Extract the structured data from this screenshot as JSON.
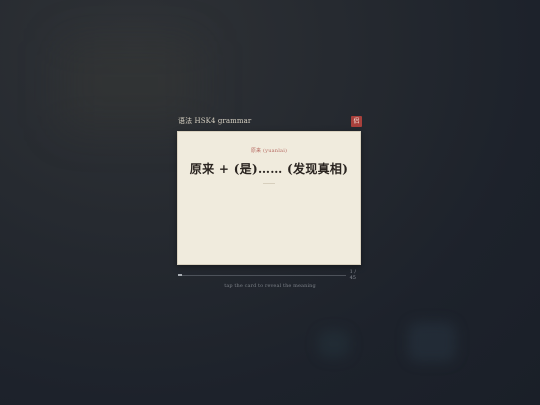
{
  "deck": {
    "title": "语法 HSK4 grammar",
    "badge": "侣"
  },
  "card": {
    "pinyin_line": "原来 (yuanlai)",
    "headline": "原来 + (是)…… (发现真相)"
  },
  "progress": {
    "current": 1,
    "total": 45,
    "fraction": 0.022,
    "label": "1 / 45"
  },
  "hint": "tap the card to reveal the meaning",
  "colors": {
    "badge": "#a8403c",
    "card": "#f0ebdd",
    "pinyin": "#b5675f",
    "background": "#1d222b"
  }
}
